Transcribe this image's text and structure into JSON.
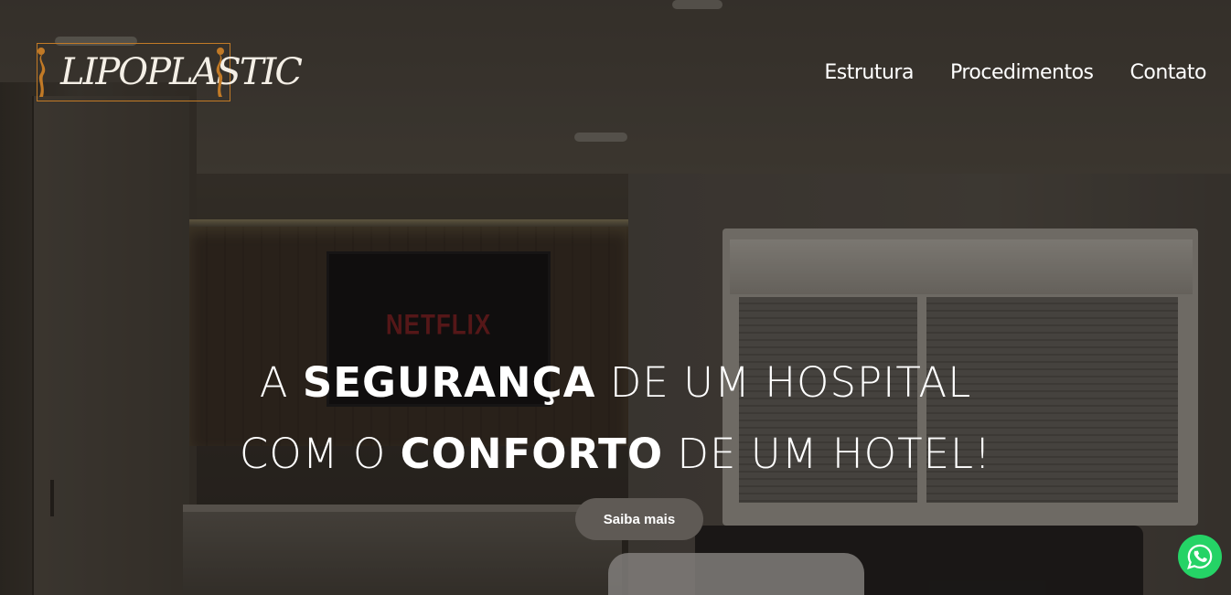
{
  "brand": {
    "logo_text": "LIPOPLASTIC",
    "accent_color": "#c27a26"
  },
  "nav": {
    "items": [
      {
        "label": "Estrutura"
      },
      {
        "label": "Procedimentos"
      },
      {
        "label": "Contato"
      }
    ]
  },
  "hero": {
    "line1": {
      "a": "A ",
      "b": "SEGURANÇA",
      "c": " DE UM HOSPITAL"
    },
    "line2": {
      "a": "COM O ",
      "b": "CONFORTO",
      "c": " DE UM HOTEL!"
    },
    "cta_label": "Saiba mais",
    "background_tv_text": "NETFLIX"
  },
  "whatsapp": {
    "icon": "whatsapp-icon",
    "color": "#25d366"
  }
}
